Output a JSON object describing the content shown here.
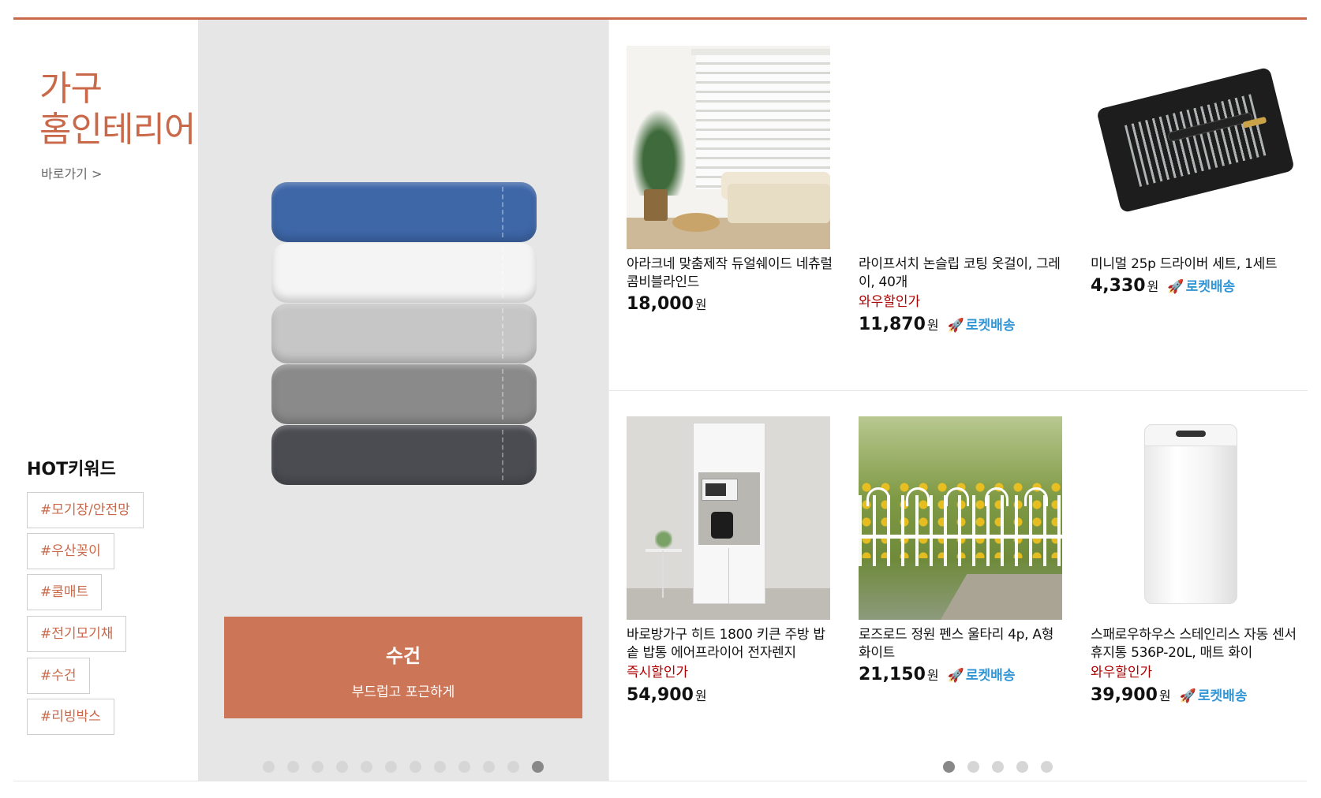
{
  "category": {
    "title_line1": "가구",
    "title_line2": "홈인테리어",
    "link_label": "바로가기 >"
  },
  "hot_keywords": {
    "title": "HOT키워드",
    "items": [
      "#모기장/안전망",
      "#우산꽂이",
      "#쿨매트",
      "#전기모기채",
      "#수건",
      "#리빙박스"
    ]
  },
  "banner": {
    "title": "수건",
    "subtitle": "부드럽고 포근하게",
    "slide_count": 12,
    "active_slide": 12
  },
  "products": [
    {
      "name": "아라크네 맞춤제작 듀얼쉐이드 네츄럴 콤비블라인드",
      "discount_label": "",
      "price": "18,000",
      "currency": "원",
      "rocket": false,
      "image": "blinds-living-room"
    },
    {
      "name": "라이프서치 논슬립 코팅 옷걸이, 그레이, 40개",
      "discount_label": "와우할인가",
      "price": "11,870",
      "currency": "원",
      "rocket": true,
      "image": "gray-hangers"
    },
    {
      "name": "미니멀 25p 드라이버 세트, 1세트",
      "discount_label": "",
      "price": "4,330",
      "currency": "원",
      "rocket": true,
      "image": "screwdriver-set"
    },
    {
      "name": "바로방가구 히트 1800 키큰 주방 밥솥 밥통 에어프라이어 전자렌지",
      "discount_label": "즉시할인가",
      "price": "54,900",
      "currency": "원",
      "rocket": false,
      "image": "kitchen-cabinet"
    },
    {
      "name": "로즈로드 정원 펜스 울타리 4p, A형 화이트",
      "discount_label": "",
      "price": "21,150",
      "currency": "원",
      "rocket": true,
      "image": "garden-fence"
    },
    {
      "name": "스패로우하우스 스테인리스 자동 센서 휴지통 536P-20L, 매트 화이",
      "discount_label": "와우할인가",
      "price": "39,900",
      "currency": "원",
      "rocket": true,
      "image": "sensor-trash-can"
    }
  ],
  "rocket_label": "로켓배송",
  "product_pager": {
    "page_count": 5,
    "active_page": 1
  },
  "colors": {
    "accent": "#c9694a",
    "banner_caption": "#cd7657",
    "discount": "#ae0000",
    "rocket": "#3295d6"
  }
}
